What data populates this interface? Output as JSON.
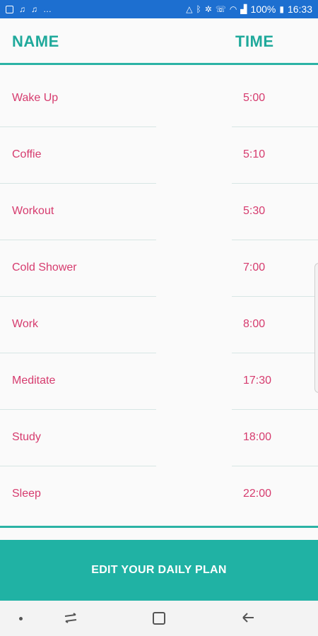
{
  "status_bar": {
    "battery": "100%",
    "time": "16:33",
    "overflow": "…"
  },
  "header": {
    "name_col": "NAME",
    "time_col": "TIME"
  },
  "plan": [
    {
      "name": "Wake Up",
      "time": "5:00"
    },
    {
      "name": "Coffie",
      "time": "5:10"
    },
    {
      "name": "Workout",
      "time": "5:30"
    },
    {
      "name": "Cold Shower",
      "time": "7:00"
    },
    {
      "name": "Work",
      "time": "8:00"
    },
    {
      "name": "Meditate",
      "time": "17:30"
    },
    {
      "name": "Study",
      "time": "18:00"
    },
    {
      "name": "Sleep",
      "time": "22:00"
    }
  ],
  "edit_button": "EDIT YOUR DAILY PLAN",
  "colors": {
    "accent": "#20b2a4",
    "text_pink": "#d63b6e",
    "status_bar": "#1d6fd0"
  }
}
